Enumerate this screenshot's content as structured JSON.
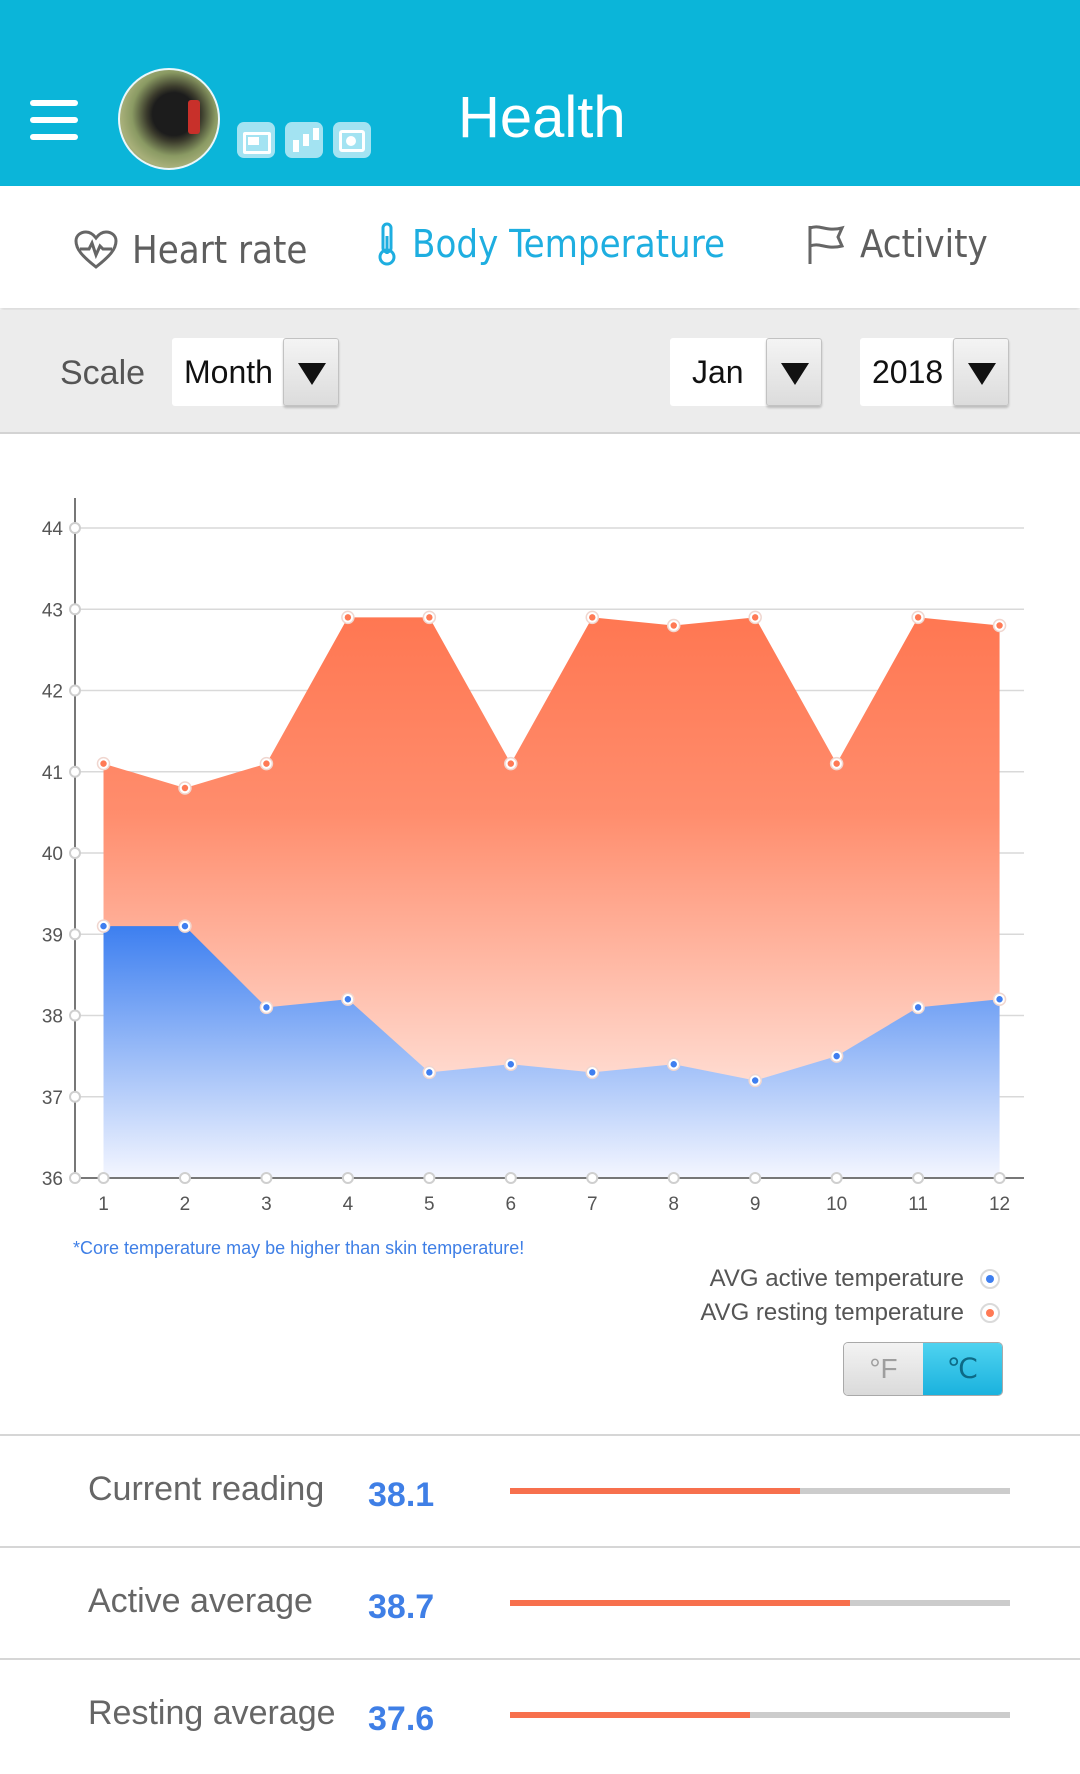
{
  "header": {
    "title": "Health",
    "colors": {
      "bar": "#0bb5d9"
    }
  },
  "tabs": [
    {
      "label": "Heart rate",
      "icon": "heart-pulse-icon",
      "active": false
    },
    {
      "label": "Body Temperature",
      "icon": "thermometer-icon",
      "active": true
    },
    {
      "label": "Activity",
      "icon": "flag-icon",
      "active": false
    }
  ],
  "filters": {
    "scale_label": "Scale",
    "scale_value": "Month",
    "month_value": "Jan",
    "year_value": "2018"
  },
  "chart_data": {
    "type": "area",
    "x": [
      1,
      2,
      3,
      4,
      5,
      6,
      7,
      8,
      9,
      10,
      11,
      12
    ],
    "yticks": [
      36,
      37,
      38,
      39,
      40,
      41,
      42,
      43,
      44
    ],
    "ylim": [
      36,
      44
    ],
    "xlim": [
      0.65,
      12.3
    ],
    "grid": true,
    "series": [
      {
        "name": "AVG resting temperature",
        "color": "#ff7a55",
        "values": [
          41.1,
          40.8,
          41.1,
          42.9,
          42.9,
          41.1,
          42.9,
          42.8,
          42.9,
          41.1,
          42.9,
          42.8
        ]
      },
      {
        "name": "AVG active temperature",
        "color": "#3f7ff0",
        "values": [
          39.1,
          39.1,
          38.1,
          38.2,
          37.3,
          37.4,
          37.3,
          37.4,
          37.2,
          37.5,
          38.1,
          38.2
        ]
      }
    ],
    "legend_position": "bottom-right"
  },
  "chart_note": "*Core temperature may be higher than skin temperature!",
  "legend": [
    {
      "label": "AVG active temperature",
      "color": "#3f7ff0"
    },
    {
      "label": "AVG resting temperature",
      "color": "#ff7a55"
    }
  ],
  "units": {
    "fahrenheit": "°F",
    "celsius": "℃",
    "selected": "celsius"
  },
  "summary": [
    {
      "label": "Current reading",
      "value": "38.1",
      "progress": 0.58
    },
    {
      "label": "Active average",
      "value": "38.7",
      "progress": 0.68
    },
    {
      "label": "Resting average",
      "value": "37.6",
      "progress": 0.48
    }
  ],
  "colors": {
    "accent_blue": "#1eaee0",
    "value_blue": "#3f7fe6",
    "bar_fill": "#f7704d"
  }
}
